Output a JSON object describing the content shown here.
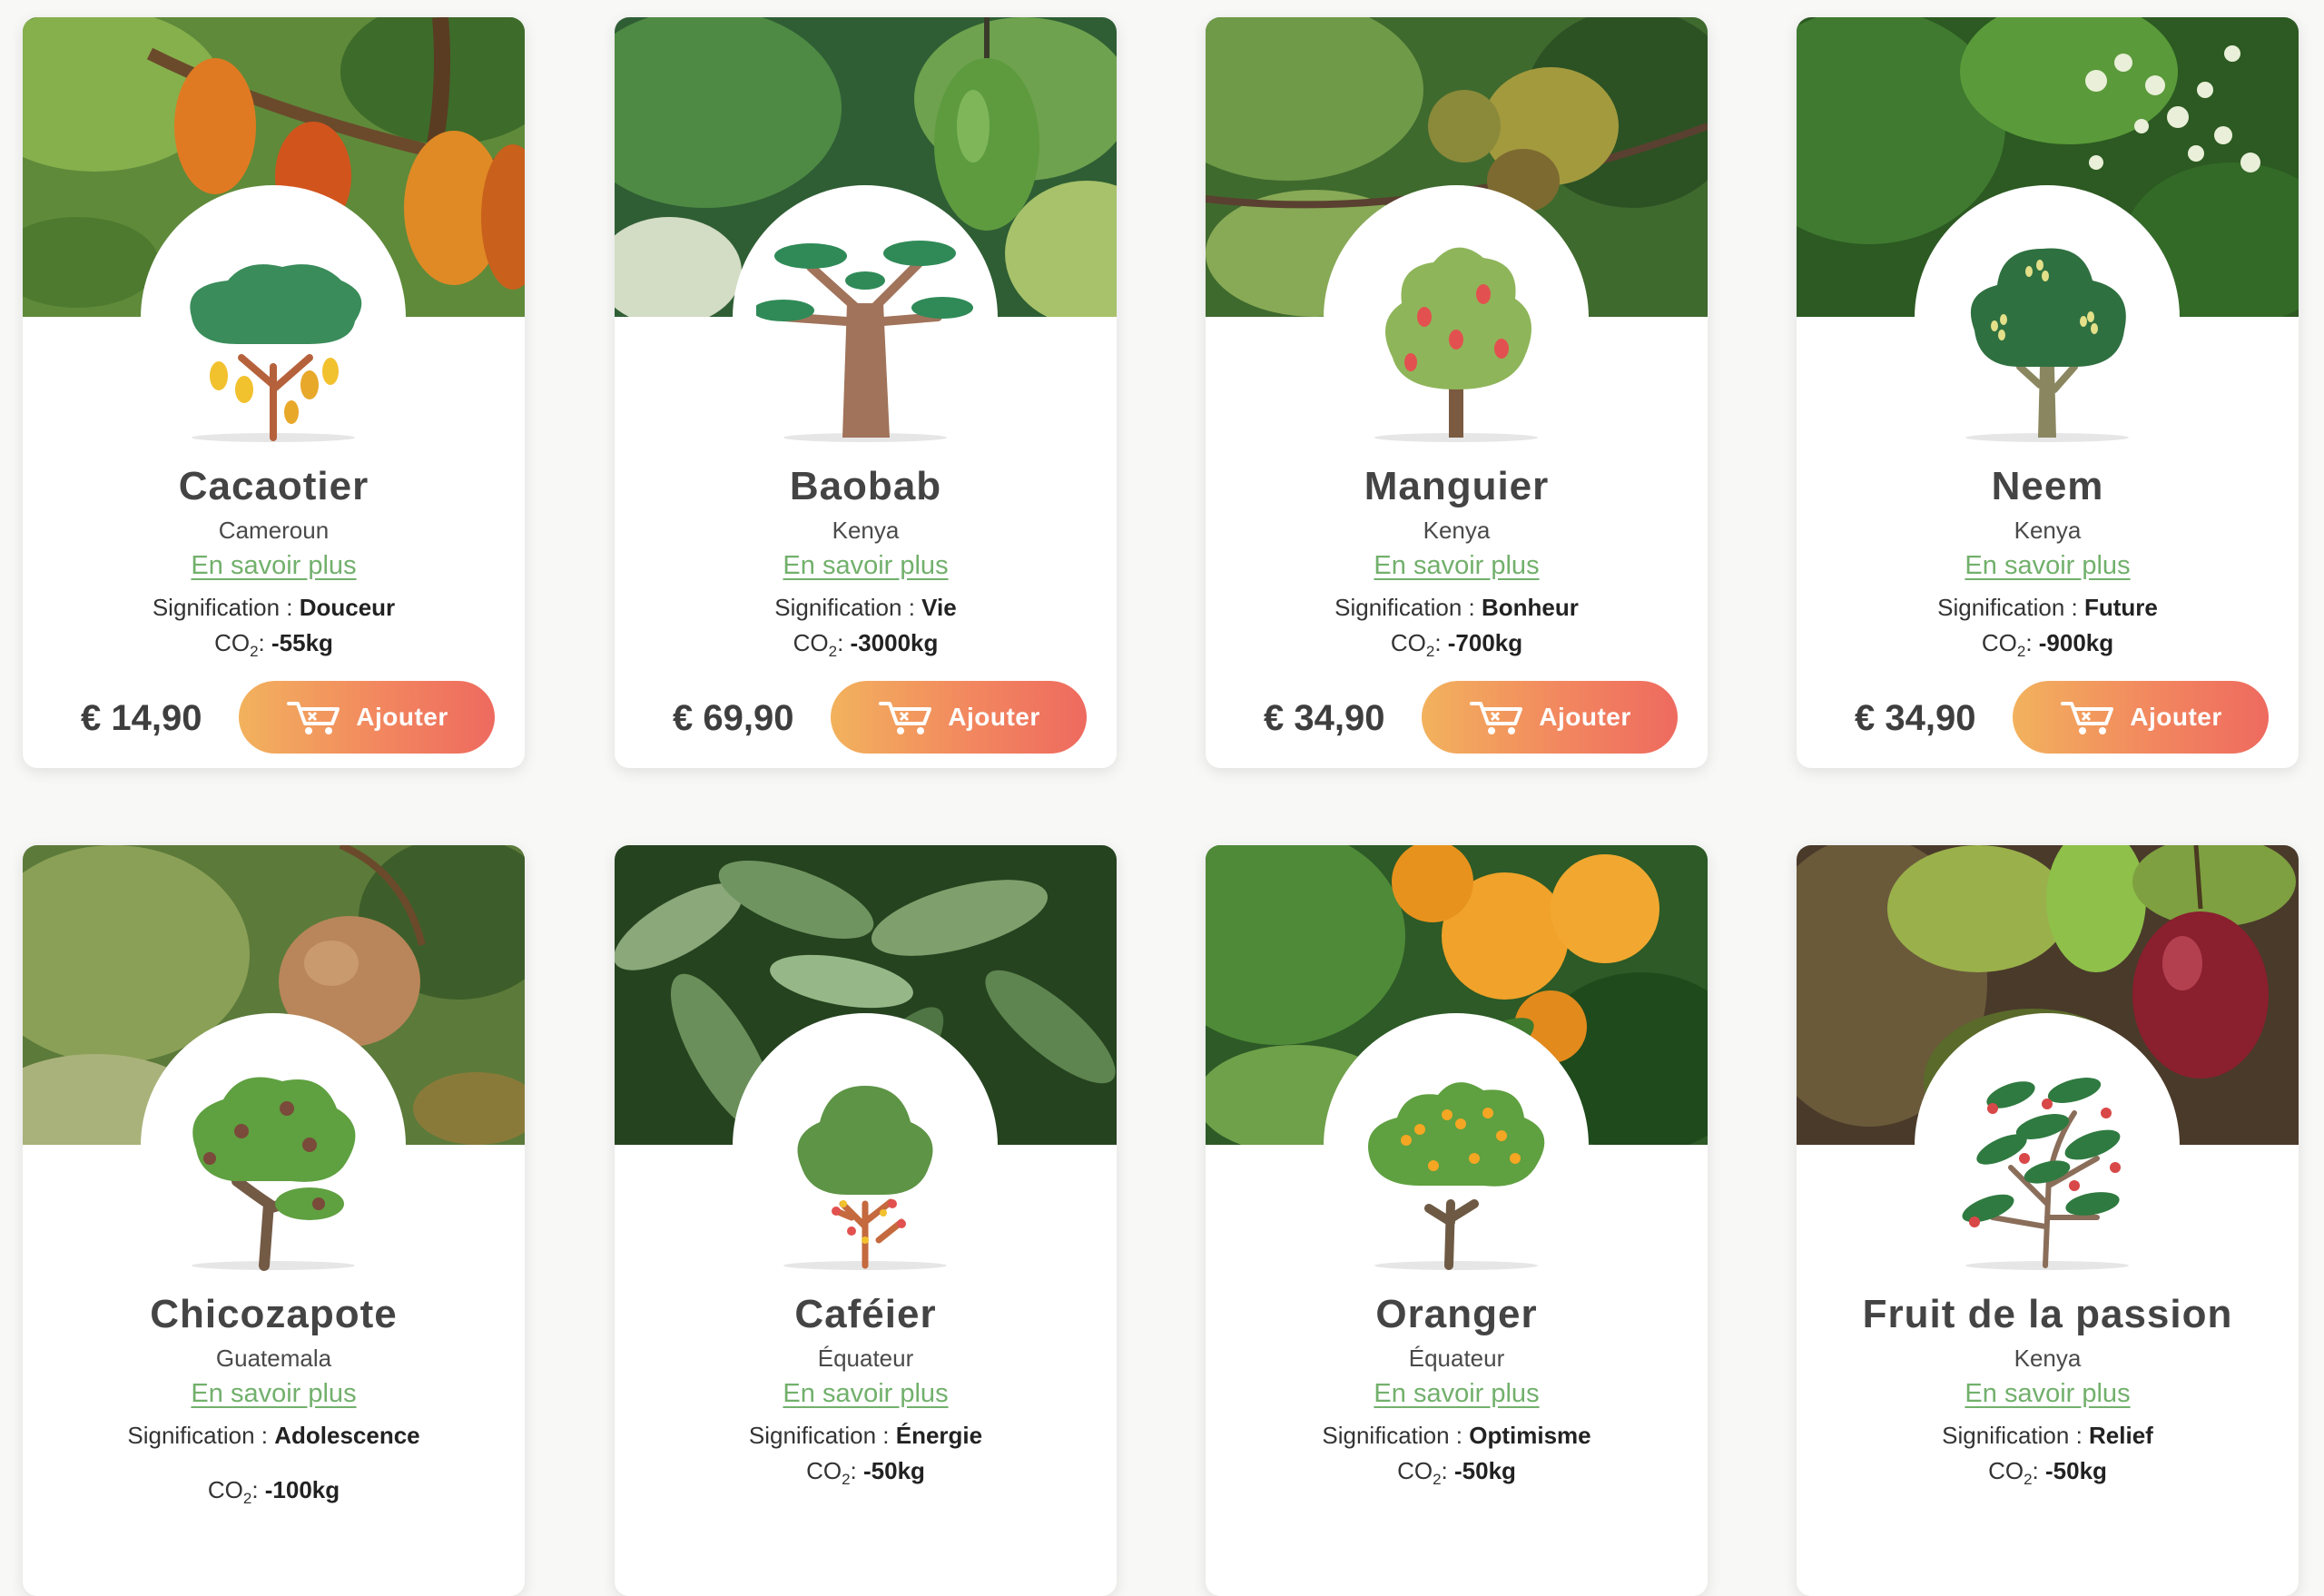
{
  "labels": {
    "more": "En savoir plus",
    "meaning_prefix": "Signification : ",
    "co2_prefix": "CO",
    "co2_sub": "2",
    "co2_sep": ": ",
    "add": "Ajouter"
  },
  "products": [
    {
      "name": "Cacaotier",
      "origin": "Cameroun",
      "meaning": "Douceur",
      "co2": "-55kg",
      "price": "€ 14,90",
      "photo_icon": "cacao-pods-photo",
      "tree_icon": "cacao-tree-icon"
    },
    {
      "name": "Baobab",
      "origin": "Kenya",
      "meaning": "Vie",
      "co2": "-3000kg",
      "price": "€ 69,90",
      "photo_icon": "baobab-fruit-photo",
      "tree_icon": "baobab-tree-icon"
    },
    {
      "name": "Manguier",
      "origin": "Kenya",
      "meaning": "Bonheur",
      "co2": "-700kg",
      "price": "€ 34,90",
      "photo_icon": "mango-fruit-photo",
      "tree_icon": "mango-tree-icon"
    },
    {
      "name": "Neem",
      "origin": "Kenya",
      "meaning": "Future",
      "co2": "-900kg",
      "price": "€ 34,90",
      "photo_icon": "neem-flowers-photo",
      "tree_icon": "neem-tree-icon"
    },
    {
      "name": "Chicozapote",
      "origin": "Guatemala",
      "meaning": "Adolescence",
      "co2": "-100kg",
      "price": "",
      "photo_icon": "sapodilla-fruit-photo",
      "tree_icon": "sapodilla-tree-icon"
    },
    {
      "name": "Caféier",
      "origin": "Équateur",
      "meaning": "Énergie",
      "co2": "-50kg",
      "price": "",
      "photo_icon": "coffee-leaves-photo",
      "tree_icon": "coffee-tree-icon"
    },
    {
      "name": "Oranger",
      "origin": "Équateur",
      "meaning": "Optimisme",
      "co2": "-50kg",
      "price": "",
      "photo_icon": "oranges-photo",
      "tree_icon": "orange-tree-icon"
    },
    {
      "name": "Fruit de la passion",
      "origin": "Kenya",
      "meaning": "Relief",
      "co2": "-50kg",
      "price": "",
      "photo_icon": "passion-fruit-photo",
      "tree_icon": "passion-fruit-tree-icon"
    }
  ]
}
